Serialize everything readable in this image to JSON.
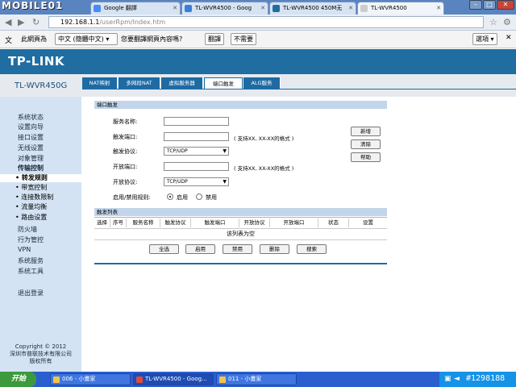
{
  "browser": {
    "watermark": "MOBILE01",
    "tabs": [
      {
        "title": "Google 翻譯",
        "icon": "google-translate-icon"
      },
      {
        "title": "TL-WVR4500 - Goog",
        "icon": "google-icon"
      },
      {
        "title": "TL-WVR4500 450M无",
        "icon": "tp-link-icon"
      },
      {
        "title": "TL-WVR4500",
        "icon": "page-icon"
      }
    ],
    "url_host": "192.168.1.1",
    "url_path": "/userRpm/Index.htm"
  },
  "translate_bar": {
    "prefix": "此網頁為",
    "language": "中文 (簡體中文)",
    "question": "您要翻譯網頁內容嗎?",
    "translate_btn": "翻譯",
    "no_btn": "不需要",
    "options_btn": "選項"
  },
  "router": {
    "logo": "TP-LINK",
    "model": "TL-WVR450G",
    "top_tabs": [
      "NAT映射",
      "多网段NAT",
      "虚拟服务器",
      "端口触发",
      "ALG服务"
    ],
    "active_tab": 3,
    "sidebar": {
      "items": [
        "系统状态",
        "设置向导",
        "接口设置",
        "无线设置",
        "对象管理"
      ],
      "active_group": "传输控制",
      "subitems": [
        "• 转发规则",
        "• 带宽控制",
        "• 连接数限制",
        "• 流量均衡",
        "• 路由设置"
      ],
      "items2": [
        "防火墙",
        "行为管控",
        "VPN",
        "系统服务",
        "系统工具"
      ],
      "logout": "退出登录",
      "copyright": [
        "Copyright © 2012",
        "深圳市普联技术有限公司",
        "版权所有"
      ]
    },
    "form": {
      "section_title": "端口触发",
      "service_name_label": "服务名称:",
      "trigger_port_label": "触发端口:",
      "trigger_port_note": "( 支持XX, XX-XX的格式 )",
      "trigger_protocol_label": "触发协议:",
      "trigger_protocol_value": "TCP/UDP",
      "open_port_label": "开放端口:",
      "open_port_note": "( 支持XX, XX-XX的格式 )",
      "open_protocol_label": "开放协议:",
      "open_protocol_value": "TCP/UDP",
      "enable_label": "启用/禁用规则:",
      "enable_option": "启用",
      "disable_option": "禁用",
      "add_btn": "新增",
      "clear_btn": "清除",
      "help_btn": "帮助"
    },
    "list": {
      "section_title": "触发列表",
      "columns": [
        "选择",
        "序号",
        "服务名称",
        "触发协议",
        "触发端口",
        "开放协议",
        "开放端口",
        "状态",
        "设置"
      ],
      "empty_text": "该列表为空",
      "buttons": [
        "全选",
        "启用",
        "禁用",
        "删除",
        "搜索"
      ]
    }
  },
  "taskbar": {
    "start_label": "开始",
    "tasks": [
      "006 - 小畫家",
      "TL-WVR4500 - Goog...",
      "011 - 小畫家"
    ],
    "stamp": "#1298188"
  }
}
